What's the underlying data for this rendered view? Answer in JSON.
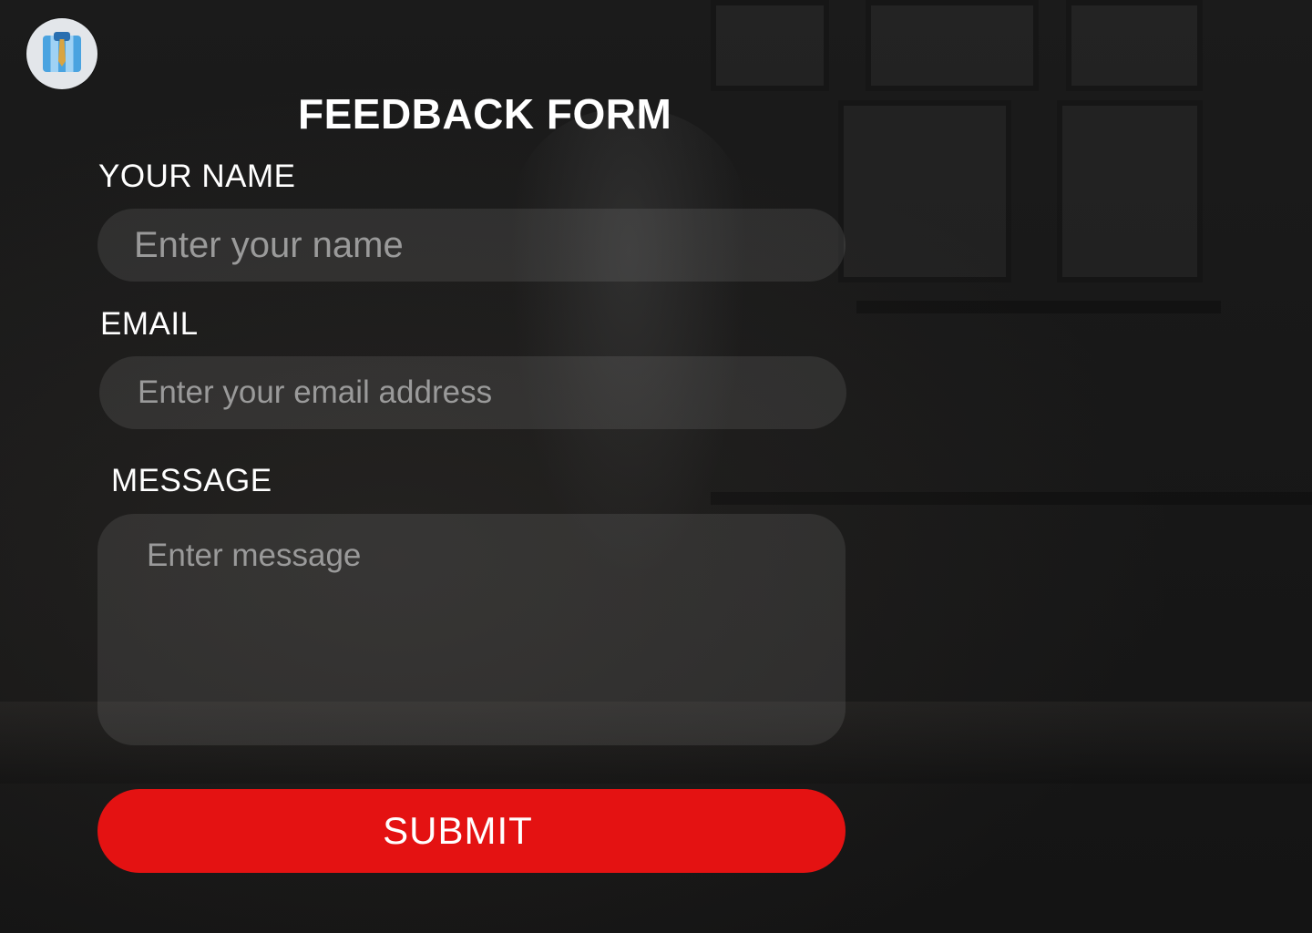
{
  "avatar": {
    "icon": "shirt-icon"
  },
  "form": {
    "title": "FEEDBACK FORM",
    "name": {
      "label": "YOUR NAME",
      "placeholder": "Enter your name",
      "value": ""
    },
    "email": {
      "label": "EMAIL",
      "placeholder": "Enter your email address",
      "value": ""
    },
    "message": {
      "label": "MESSAGE",
      "placeholder": "Enter message",
      "value": ""
    },
    "submit_label": "SUBMIT"
  },
  "colors": {
    "accent": "#e41212",
    "background": "#161616",
    "field_bg": "rgba(255,255,255,0.09)",
    "text": "#ffffff",
    "placeholder": "#9a9a9a"
  }
}
